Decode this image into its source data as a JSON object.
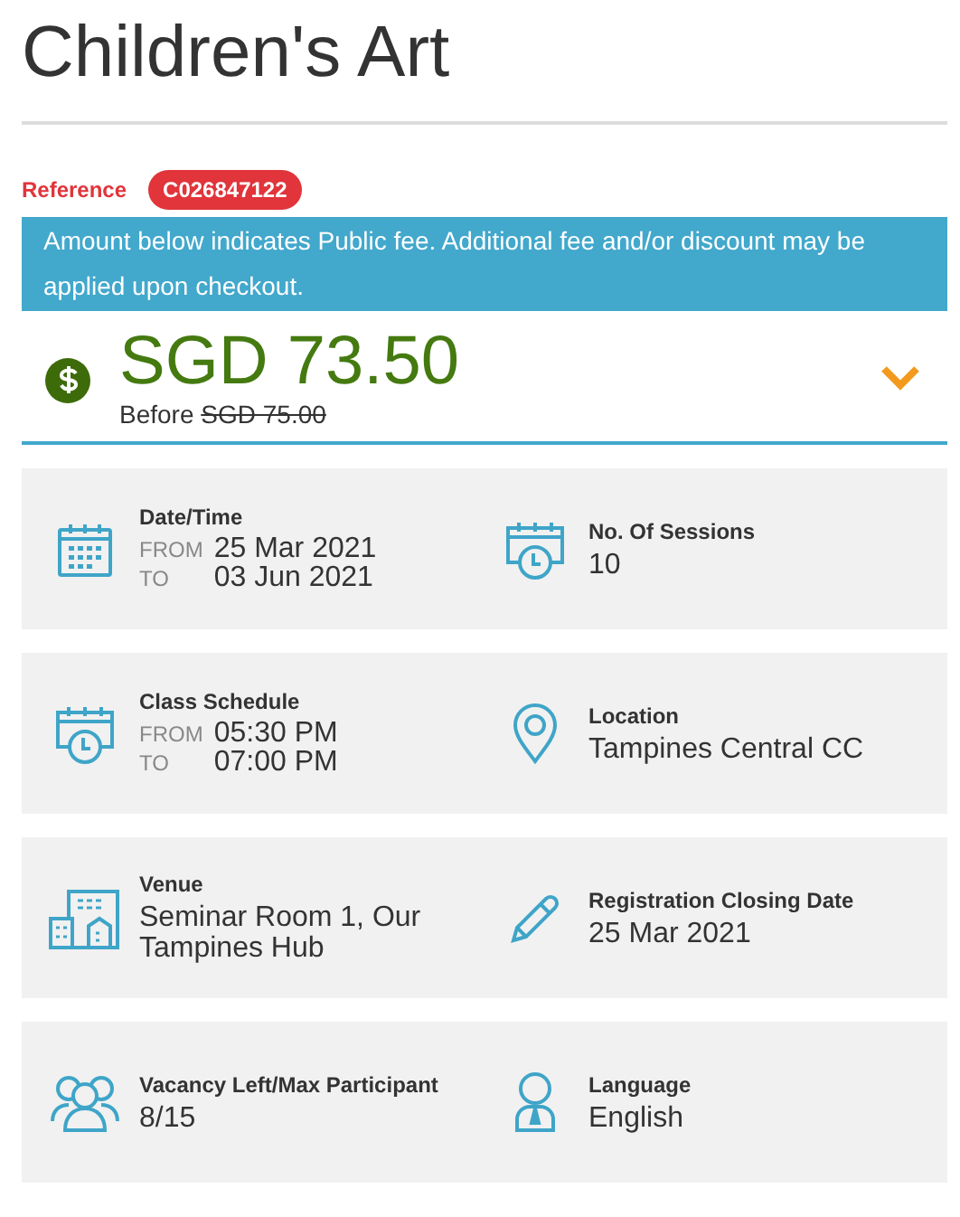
{
  "title": "Children's Art",
  "reference": {
    "label": "Reference",
    "code": "C026847122"
  },
  "notice": "Amount below indicates Public fee. Additional fee and/or discount may be applied upon checkout.",
  "fee": {
    "amount": "SGD 73.50",
    "before_label": "Before",
    "before_amount": "SGD 75.00",
    "expanded": false
  },
  "cards": [
    {
      "cells": [
        {
          "label": "Date/Time",
          "kind": "range",
          "from_label": "FROM",
          "from": "25 Mar 2021",
          "to_label": "TO",
          "to": "03 Jun 2021"
        },
        {
          "label": "No. Of Sessions",
          "kind": "value",
          "value": "10"
        }
      ]
    },
    {
      "cells": [
        {
          "label": "Class Schedule",
          "kind": "range",
          "from_label": "FROM",
          "from": "05:30 PM",
          "to_label": "TO",
          "to": "07:00 PM"
        },
        {
          "label": "Location",
          "kind": "value",
          "value": "Tampines Central CC"
        }
      ]
    },
    {
      "cells": [
        {
          "label": "Venue",
          "kind": "value",
          "value": "Seminar Room 1, Our Tampines Hub"
        },
        {
          "label": "Registration Closing Date",
          "kind": "value",
          "value": "25 Mar 2021"
        }
      ]
    },
    {
      "cells": [
        {
          "label": "Vacancy Left/Max Participant",
          "kind": "value",
          "value": "8/15"
        },
        {
          "label": "Language",
          "kind": "value",
          "value": "English"
        }
      ]
    }
  ]
}
